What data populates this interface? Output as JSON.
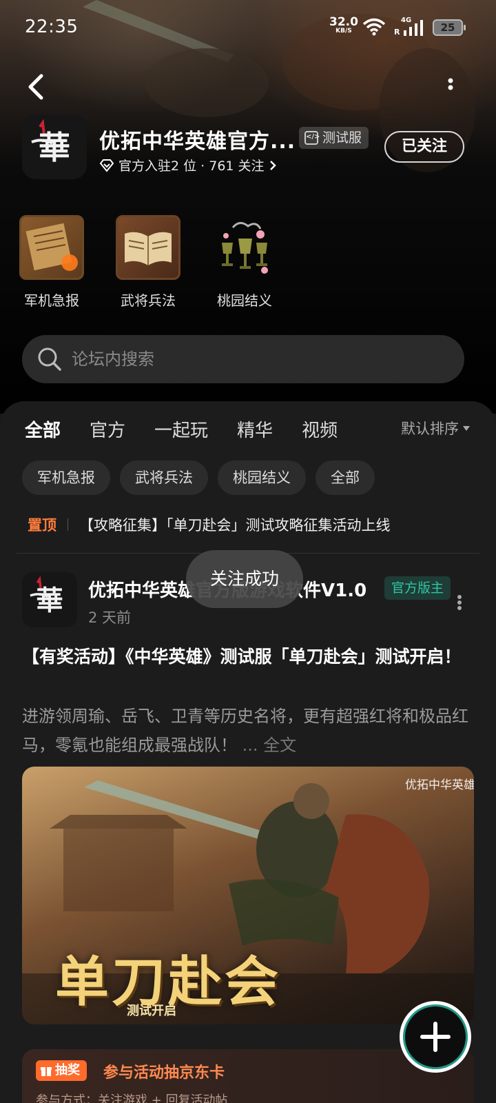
{
  "status_bar": {
    "time": "22:35",
    "net_speed": "32.0",
    "net_speed_unit": "KB/S",
    "signal_type": "4G",
    "roaming": "R",
    "battery": "25"
  },
  "header": {
    "app_name": "优拓中华英雄官方...",
    "badge": "测试服",
    "stats": "官方入驻2 位 · 761 关注",
    "follow_label": "已关注"
  },
  "quick_links": [
    {
      "label": "军机急报",
      "icon": "scroll-icon"
    },
    {
      "label": "武将兵法",
      "icon": "book-icon"
    },
    {
      "label": "桃园结义",
      "icon": "goblets-icon"
    }
  ],
  "search": {
    "placeholder": "论坛内搜索"
  },
  "tabs": [
    "全部",
    "官方",
    "一起玩",
    "精华",
    "视频"
  ],
  "active_tab": "全部",
  "sort_label": "默认排序",
  "chips": [
    "军机急报",
    "武将兵法",
    "桃园结义",
    "全部"
  ],
  "pinned": {
    "tag": "置顶",
    "text": "【攻略征集】「单刀赴会」测试攻略征集活动上线"
  },
  "post": {
    "author": "优拓中华英雄官方版游戏软件V1.0",
    "badge": "官方版主",
    "time": "2 天前",
    "title": "【有奖活动】《中华英雄》测试服「单刀赴会」测试开启！",
    "body": "进游领周瑜、岳飞、卫青等历史名将，更有超强红将和极品红马，零氪也能组成最强战队！",
    "more": "... 全文",
    "image_title": "单刀赴会",
    "image_subtitle": "测试开启",
    "image_logo": "优拓中华英雄"
  },
  "prize": {
    "tag": "抽奖",
    "title": "参与活动抽京东卡",
    "desc": "参与方式：关注游戏 + 回复活动帖"
  },
  "toast": "关注成功",
  "colors": {
    "accent": "#2fb89a",
    "pinned": "#ff7d3b",
    "prize": "#ff6b2c"
  }
}
